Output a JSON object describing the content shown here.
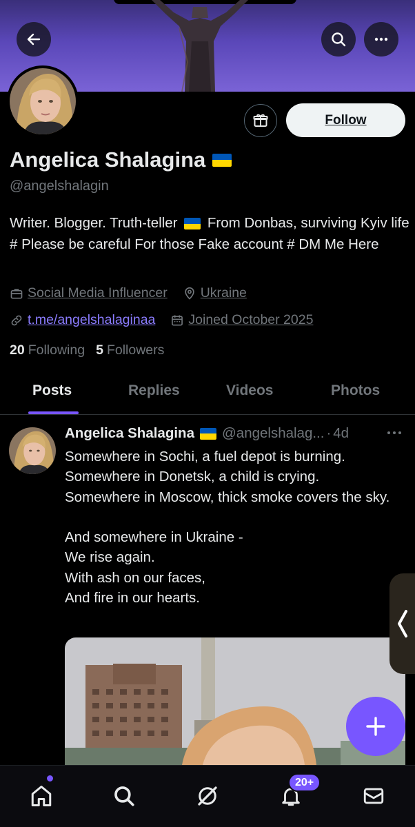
{
  "profile": {
    "name": "Angelica Shalagina",
    "handle": "@angelshalagin",
    "bio_part1": "Writer. Blogger. Truth-teller",
    "bio_part2": "From Donbas, surviving Kyiv life # Please be careful For those Fake account # DM Me Here",
    "category": "Social Media Influencer",
    "location": "Ukraine",
    "website": "t.me/angelshalaginaa",
    "joined": "Joined October 2025",
    "following_count": "20",
    "following_label": "Following",
    "followers_count": "5",
    "followers_label": "Followers"
  },
  "actions": {
    "follow_label": "Follow"
  },
  "tabs": [
    {
      "label": "Posts",
      "active": true
    },
    {
      "label": "Replies",
      "active": false
    },
    {
      "label": "Videos",
      "active": false
    },
    {
      "label": "Photos",
      "active": false
    }
  ],
  "post": {
    "author_name": "Angelica Shalagina",
    "author_handle": "@angelshalag...",
    "separator": "·",
    "time": "4d",
    "text": "Somewhere in Sochi, a fuel depot is burning.\nSomewhere in Donetsk, a child is crying.\nSomewhere in Moscow, thick smoke covers the sky.\n\nAnd somewhere in Ukraine -\nWe rise again.\nWith ash on our faces,\nAnd fire in our hearts."
  },
  "nav": {
    "notifications_badge": "20+"
  },
  "colors": {
    "accent": "#7856ff",
    "background": "#000000",
    "text_primary": "#e7e9ea",
    "text_secondary": "#71767b",
    "flag_blue": "#0057b7",
    "flag_yellow": "#ffd700"
  },
  "icons": [
    "back-arrow-icon",
    "search-icon",
    "more-icon",
    "gift-icon",
    "briefcase-icon",
    "location-pin-icon",
    "link-icon",
    "calendar-icon",
    "more-horizontal-icon",
    "chevron-left-icon",
    "plus-icon",
    "home-icon",
    "grok-icon",
    "bell-icon",
    "mail-icon"
  ]
}
